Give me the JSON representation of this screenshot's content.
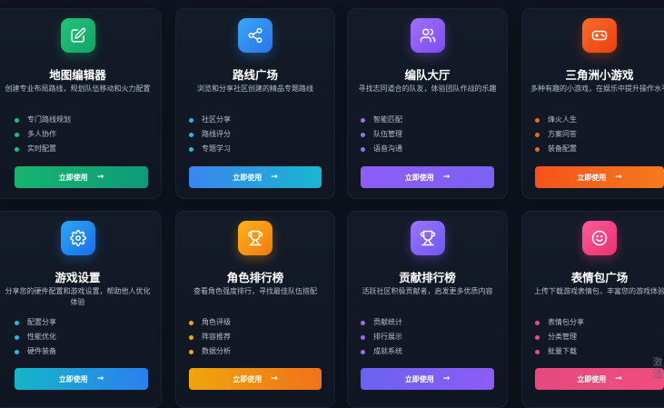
{
  "cards": [
    {
      "title": "地图编辑器",
      "desc": "创建专业布局路线，规划队伍移动和火力配置",
      "features": [
        "专门路线规划",
        "多人协作",
        "实时配置"
      ],
      "button": "立即使用",
      "icon": "edit-icon",
      "accent": "#19b46e"
    },
    {
      "title": "路线广场",
      "desc": "浏览和分享社区创建的精品专题路线",
      "features": [
        "社区分享",
        "路线评分",
        "专题学习"
      ],
      "button": "立即使用",
      "icon": "share-icon",
      "accent": "#2f8ff0"
    },
    {
      "title": "编队大厅",
      "desc": "寻找志同道合的队友，体验团队作战的乐趣",
      "features": [
        "智能匹配",
        "队伍管理",
        "语音沟通"
      ],
      "button": "立即使用",
      "icon": "users-icon",
      "accent": "#8d5cf6"
    },
    {
      "title": "三角洲小游戏",
      "desc": "多种有趣的小游戏，在娱乐中提升操作水平",
      "features": [
        "烽火人生",
        "方案问答",
        "装备配置"
      ],
      "button": "立即使用",
      "icon": "gamepad-icon",
      "accent": "#f2541b"
    },
    {
      "title": "游戏设置",
      "desc": "分享您的硬件配置和游戏设置，帮助他人优化体验",
      "features": [
        "配置分享",
        "性能优化",
        "硬件装备"
      ],
      "button": "立即使用",
      "icon": "gear-icon",
      "accent": "#1d8ff0"
    },
    {
      "title": "角色排行榜",
      "desc": "查看角色强度排行，寻找最佳队伍搭配",
      "features": [
        "角色评级",
        "阵容推荐",
        "数据分析"
      ],
      "button": "立即使用",
      "icon": "trophy-icon",
      "accent": "#f59b0f"
    },
    {
      "title": "贡献排行榜",
      "desc": "活跃社区积极贡献者，启发更多优质内容",
      "features": [
        "贡献统计",
        "排行展示",
        "成就系统"
      ],
      "button": "立即使用",
      "icon": "trophy-icon",
      "accent": "#8b5cf6"
    },
    {
      "title": "表情包广场",
      "desc": "上传下载游戏表情包，丰富您的游戏体验",
      "features": [
        "表情包分享",
        "分类管理",
        "批量下载"
      ],
      "button": "立即使用",
      "icon": "smile-icon",
      "accent": "#ec3f86"
    }
  ],
  "watermark": "激活"
}
